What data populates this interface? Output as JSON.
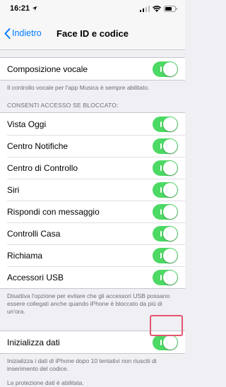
{
  "status": {
    "time": "16:21"
  },
  "nav": {
    "back_label": "Indietro",
    "title": "Face ID e codice"
  },
  "voice_dial": {
    "label": "Composizione vocale",
    "on": true,
    "footer": "Il controllo vocale per l'app Musica è sempre abilitato."
  },
  "locked_access": {
    "header": "CONSENTI ACCESSO SE BLOCCATO:",
    "items": [
      {
        "label": "Vista Oggi",
        "on": true
      },
      {
        "label": "Centro Notifiche",
        "on": true
      },
      {
        "label": "Centro di Controllo",
        "on": true
      },
      {
        "label": "Siri",
        "on": true
      },
      {
        "label": "Rispondi con messaggio",
        "on": true
      },
      {
        "label": "Controlli Casa",
        "on": true
      },
      {
        "label": "Richiama",
        "on": true
      },
      {
        "label": "Accessori USB",
        "on": true
      }
    ],
    "footer": "Disattiva l'opzione per evitare che gli accessori USB possano essere collegati anche quando iPhone è bloccato da più di un'ora."
  },
  "erase_data": {
    "label": "Inizializza dati",
    "on": true,
    "footer": "Inizializza i dati di iPhone dopo 10 tentativi non riusciti di inserimento del codice.",
    "footer2": "La protezione dati è abilitata."
  },
  "colors": {
    "accent": "#007aff",
    "toggle_on": "#4cd964",
    "highlight": "#e3566e"
  }
}
